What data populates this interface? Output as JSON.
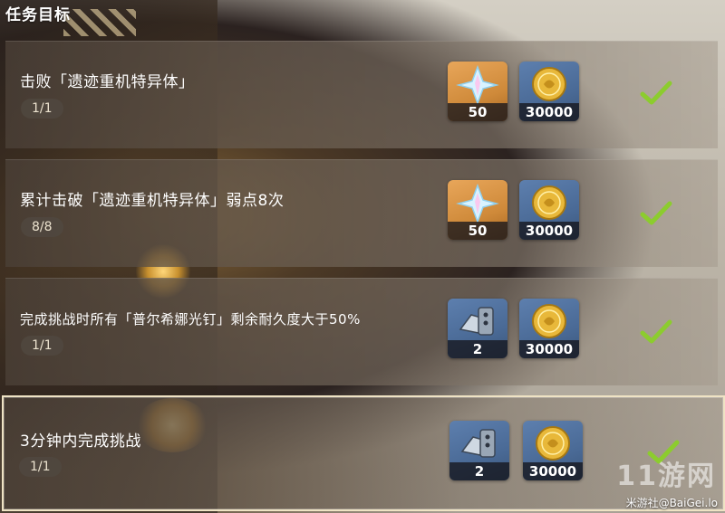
{
  "header": {
    "title": "任务目标"
  },
  "colors": {
    "check": "#8ccc2e",
    "primogem_bg": "#cf8a3a",
    "material_bg": "#4a6a96",
    "card": "#5a4c40"
  },
  "objectives": [
    {
      "title": "击败「遗迹重机特异体」",
      "progress": "1/1",
      "completed": true,
      "selected": false,
      "rewards": [
        {
          "icon": "primogem-icon",
          "count": "50"
        },
        {
          "icon": "mora-icon",
          "count": "30000"
        }
      ]
    },
    {
      "title": "累计击破「遗迹重机特异体」弱点8次",
      "progress": "8/8",
      "completed": true,
      "selected": false,
      "rewards": [
        {
          "icon": "primogem-icon",
          "count": "50"
        },
        {
          "icon": "mora-icon",
          "count": "30000"
        }
      ]
    },
    {
      "title": "完成挑战时所有「普尔希娜光钉」剩余耐久度大于50%",
      "progress": "1/1",
      "completed": true,
      "selected": false,
      "rewards": [
        {
          "icon": "crystal-ore-material-icon",
          "count": "2"
        },
        {
          "icon": "mora-icon",
          "count": "30000"
        }
      ]
    },
    {
      "title": "3分钟内完成挑战",
      "progress": "1/1",
      "completed": true,
      "selected": true,
      "rewards": [
        {
          "icon": "crystal-ore-material-icon",
          "count": "2"
        },
        {
          "icon": "mora-icon",
          "count": "30000"
        }
      ]
    }
  ],
  "watermark": {
    "logo": "11游网",
    "text": "米游社@BaiGei.lo"
  }
}
